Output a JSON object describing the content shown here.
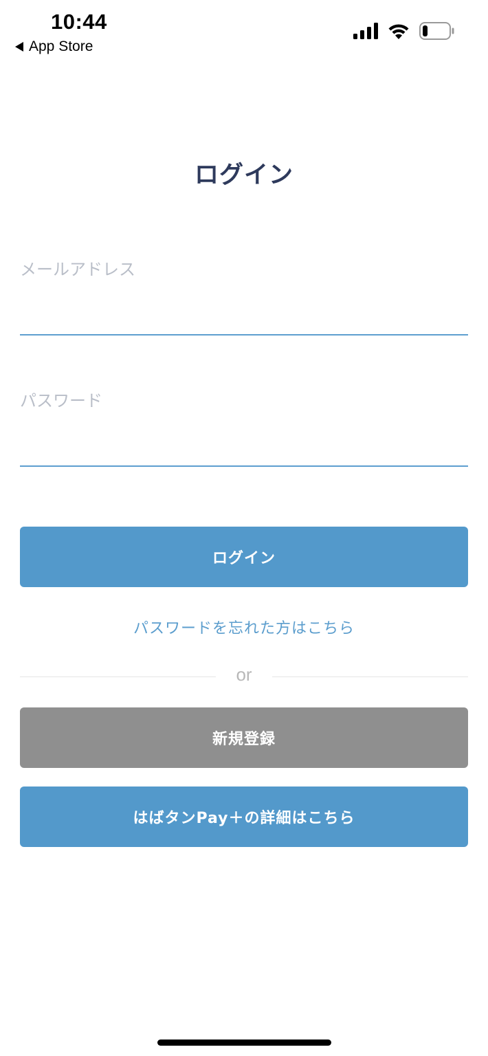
{
  "status_bar": {
    "time": "10:44",
    "back_app": "App Store",
    "signal_icon": "cellular-signal-icon",
    "wifi_icon": "wifi-icon",
    "battery_icon": "battery-icon",
    "battery_level": 0.2
  },
  "page": {
    "title": "ログイン"
  },
  "form": {
    "email_placeholder": "メールアドレス",
    "email_value": "",
    "password_placeholder": "パスワード",
    "password_value": ""
  },
  "actions": {
    "login_label": "ログイン",
    "forgot_password": "パスワードを忘れた方はこちら",
    "divider_text": "or",
    "register_label": "新規登録",
    "details_label": "はばタンPay＋の詳細はこちら"
  },
  "colors": {
    "primary": "#5399cb",
    "secondary_button": "#8f8f8f",
    "title": "#2e3a5c",
    "link": "#5b9dcd",
    "underline": "#5d9ecf"
  }
}
